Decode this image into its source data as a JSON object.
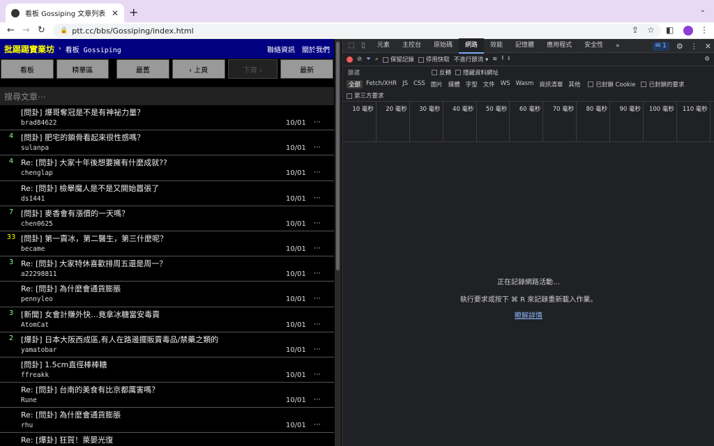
{
  "browser": {
    "tab_title": "看板 Gossiping 文章列表 - 批踢踢實業坊",
    "tab_title_short": "看板 Gossiping 文章列表 - 批踢 ",
    "url": "ptt.cc/bbs/Gossiping/index.html"
  },
  "ptt": {
    "site": "批踢踢實業坊",
    "board": "看板 Gossiping",
    "links": [
      "聯絡資訊",
      "關於我們"
    ],
    "buttons": [
      "看板",
      "精華區",
      "最舊",
      "‹ 上頁",
      "下頁 ›",
      "最新"
    ],
    "search_placeholder": "搜尋文章⋯",
    "posts": [
      {
        "count": "",
        "title": "[問卦] 爆哥奪冠是不是有神祕力量？",
        "author": "brad84622",
        "date": "10/01"
      },
      {
        "count": "4",
        "title": "[問卦] 肥宅的鎖骨看起來很性感嗎？",
        "author": "sulanpa",
        "date": "10/01"
      },
      {
        "count": "4",
        "title": "Re: [問卦] 大家十年後想要擁有什麼成就??",
        "author": "chenglap",
        "date": "10/01"
      },
      {
        "count": "",
        "title": "Re: [問卦] 檢舉魔人是不是又開始囂張了",
        "author": "ds1441",
        "date": "10/01"
      },
      {
        "count": "7",
        "title": "[問卦] 麥香會有漲價的一天嗎？",
        "author": "chen0625",
        "date": "10/01"
      },
      {
        "count": "33",
        "title": "[問卦] 第一賣冰，第二醫生，第三什麼呢？",
        "author": "became",
        "date": "10/01"
      },
      {
        "count": "3",
        "title": "Re: [問卦] 大家特休喜歡排周五還是周一？",
        "author": "a22298811",
        "date": "10/01"
      },
      {
        "count": "",
        "title": "Re: [問卦] 為什麼會通貨膨脹",
        "author": "pennyleo",
        "date": "10/01"
      },
      {
        "count": "3",
        "title": "[新聞] 女會計賺外快…竟拿冰糖當安毒賣",
        "author": "AtomCat",
        "date": "10/01"
      },
      {
        "count": "2",
        "title": "[爆卦] 日本大阪西成區,有人在路邊擺販賣毒品/禁藥之類的",
        "author": "yamatobar",
        "date": "10/01"
      },
      {
        "count": "",
        "title": "[問卦] 1.5cm直徑棒棒糖",
        "author": "ffreakk",
        "date": "10/01"
      },
      {
        "count": "",
        "title": "Re: [問卦] 台南的美食有比京都厲害嗎？",
        "author": "Rune",
        "date": "10/01"
      },
      {
        "count": "",
        "title": "Re: [問卦] 為什麼會通貨膨脹",
        "author": "rhu",
        "date": "10/01"
      },
      {
        "count": "",
        "title": "Re: [爆卦] 狂賀！萊晏光復",
        "author": "",
        "date": ""
      }
    ],
    "more": "⋯"
  },
  "devtools": {
    "tabs": [
      "元素",
      "主控台",
      "原始碼",
      "網路",
      "效能",
      "記憶體",
      "應用程式",
      "安全性"
    ],
    "active_tab": "網路",
    "issues_count": "1",
    "row2": {
      "preserve_log": "保留記錄",
      "disable_cache": "停用快取",
      "throttle": "不進行節流"
    },
    "filter_placeholder": "篩選",
    "invert": "反轉",
    "hide_data_urls": "隱藏資料網址",
    "types": [
      "全部",
      "Fetch/XHR",
      "JS",
      "CSS",
      "圖片",
      "媒體",
      "字型",
      "文件",
      "WS",
      "Wasm",
      "資訊清單",
      "其他"
    ],
    "blocked_cookies": "已封鎖 Cookie",
    "blocked_requests": "已封鎖的要求",
    "third_party": "第三方要求",
    "ticks": [
      "10 毫秒",
      "20 毫秒",
      "30 毫秒",
      "40 毫秒",
      "50 毫秒",
      "60 毫秒",
      "70 毫秒",
      "80 毫秒",
      "90 毫秒",
      "100 毫秒",
      "110 毫秒"
    ],
    "empty_line1": "正在記錄網路活動…",
    "empty_line2": "執行要求或按下 ⌘ R 來記錄重新載入作業。",
    "empty_link": "瞭解詳情"
  }
}
